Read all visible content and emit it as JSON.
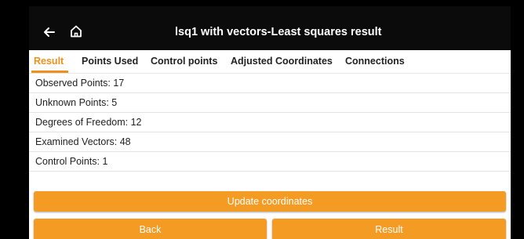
{
  "appbar": {
    "title": "lsq1 with vectors-Least squares result",
    "back_icon": "arrow-left",
    "home_icon": "home"
  },
  "tabs": [
    {
      "label": "Result",
      "active": true
    },
    {
      "label": "Points Used",
      "active": false
    },
    {
      "label": "Control points",
      "active": false
    },
    {
      "label": "Adjusted Coordinates",
      "active": false
    },
    {
      "label": "Connections",
      "active": false
    }
  ],
  "results": [
    {
      "text": "Observed Points: 17"
    },
    {
      "text": "Unknown Points: 5"
    },
    {
      "text": "Degrees of Freedom: 12"
    },
    {
      "text": "Examined Vectors: 48"
    },
    {
      "text": "Control Points: 1"
    }
  ],
  "buttons": {
    "update": "Update coordinates",
    "back": "Back",
    "result": "Result"
  },
  "colors": {
    "accent": "#f0901c",
    "button": "#f49b23",
    "appbar": "#0b0b0b"
  }
}
